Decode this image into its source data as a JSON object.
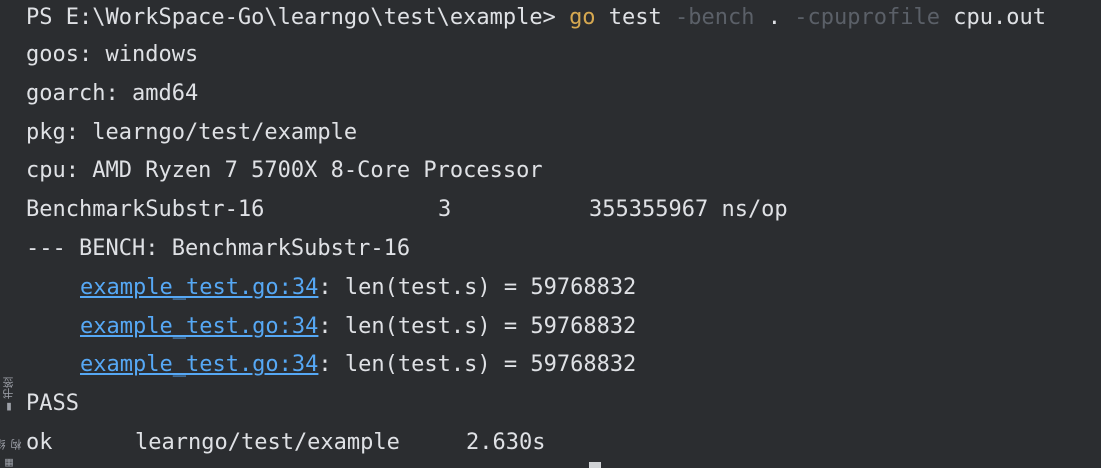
{
  "sidebar": {
    "bookmarks_label": "书签",
    "structure_label": "结构"
  },
  "terminal": {
    "prompt": "PS E:\\WorkSpace-Go\\learngo\\test\\example> ",
    "command_go": "go",
    "command_test": " test ",
    "command_flag_bench": "-bench",
    "command_dot": " . ",
    "command_flag_cpuprofile": "-cpuprofile",
    "command_output": " cpu.out",
    "goos": "goos: windows",
    "goarch": "goarch: amd64",
    "pkg": "pkg: learngo/test/example",
    "cpu": "cpu: AMD Ryzen 7 5700X 8-Core Processor",
    "benchmark_name": "BenchmarkSubstr-16",
    "benchmark_iterations": "3",
    "benchmark_result": "355355967 ns/op",
    "bench_header": "--- BENCH: BenchmarkSubstr-16",
    "log_entries": [
      {
        "link": "example_test.go:34",
        "text": ": len(test.s) = 59768832"
      },
      {
        "link": "example_test.go:34",
        "text": ": len(test.s) = 59768832"
      },
      {
        "link": "example_test.go:34",
        "text": ": len(test.s) = 59768832"
      }
    ],
    "status": "PASS",
    "ok_label": "ok",
    "ok_package": "learngo/test/example",
    "ok_time": "2.630s"
  },
  "colors": {
    "background": "#2b2d30",
    "text": "#dfe1e5",
    "keyword": "#d6a850",
    "flag": "#5b6068",
    "link": "#56a8f5"
  }
}
